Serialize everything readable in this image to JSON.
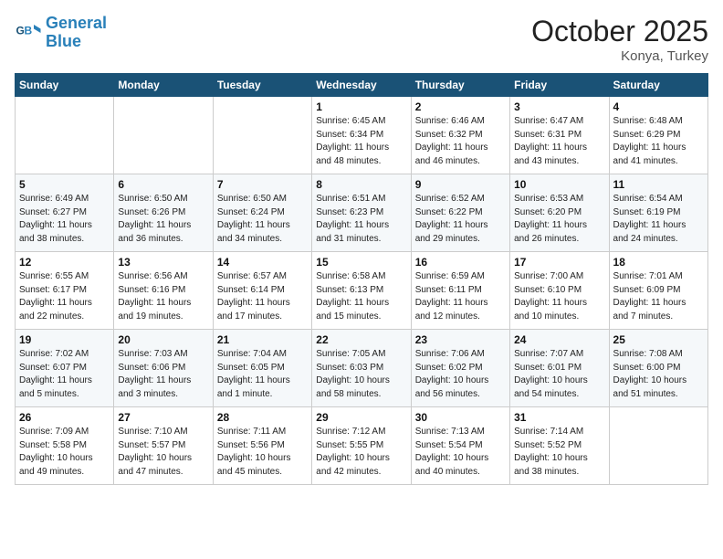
{
  "header": {
    "logo_line1": "General",
    "logo_line2": "Blue",
    "month": "October 2025",
    "location": "Konya, Turkey"
  },
  "days_of_week": [
    "Sunday",
    "Monday",
    "Tuesday",
    "Wednesday",
    "Thursday",
    "Friday",
    "Saturday"
  ],
  "weeks": [
    [
      {
        "day": "",
        "info": ""
      },
      {
        "day": "",
        "info": ""
      },
      {
        "day": "",
        "info": ""
      },
      {
        "day": "1",
        "info": "Sunrise: 6:45 AM\nSunset: 6:34 PM\nDaylight: 11 hours\nand 48 minutes."
      },
      {
        "day": "2",
        "info": "Sunrise: 6:46 AM\nSunset: 6:32 PM\nDaylight: 11 hours\nand 46 minutes."
      },
      {
        "day": "3",
        "info": "Sunrise: 6:47 AM\nSunset: 6:31 PM\nDaylight: 11 hours\nand 43 minutes."
      },
      {
        "day": "4",
        "info": "Sunrise: 6:48 AM\nSunset: 6:29 PM\nDaylight: 11 hours\nand 41 minutes."
      }
    ],
    [
      {
        "day": "5",
        "info": "Sunrise: 6:49 AM\nSunset: 6:27 PM\nDaylight: 11 hours\nand 38 minutes."
      },
      {
        "day": "6",
        "info": "Sunrise: 6:50 AM\nSunset: 6:26 PM\nDaylight: 11 hours\nand 36 minutes."
      },
      {
        "day": "7",
        "info": "Sunrise: 6:50 AM\nSunset: 6:24 PM\nDaylight: 11 hours\nand 34 minutes."
      },
      {
        "day": "8",
        "info": "Sunrise: 6:51 AM\nSunset: 6:23 PM\nDaylight: 11 hours\nand 31 minutes."
      },
      {
        "day": "9",
        "info": "Sunrise: 6:52 AM\nSunset: 6:22 PM\nDaylight: 11 hours\nand 29 minutes."
      },
      {
        "day": "10",
        "info": "Sunrise: 6:53 AM\nSunset: 6:20 PM\nDaylight: 11 hours\nand 26 minutes."
      },
      {
        "day": "11",
        "info": "Sunrise: 6:54 AM\nSunset: 6:19 PM\nDaylight: 11 hours\nand 24 minutes."
      }
    ],
    [
      {
        "day": "12",
        "info": "Sunrise: 6:55 AM\nSunset: 6:17 PM\nDaylight: 11 hours\nand 22 minutes."
      },
      {
        "day": "13",
        "info": "Sunrise: 6:56 AM\nSunset: 6:16 PM\nDaylight: 11 hours\nand 19 minutes."
      },
      {
        "day": "14",
        "info": "Sunrise: 6:57 AM\nSunset: 6:14 PM\nDaylight: 11 hours\nand 17 minutes."
      },
      {
        "day": "15",
        "info": "Sunrise: 6:58 AM\nSunset: 6:13 PM\nDaylight: 11 hours\nand 15 minutes."
      },
      {
        "day": "16",
        "info": "Sunrise: 6:59 AM\nSunset: 6:11 PM\nDaylight: 11 hours\nand 12 minutes."
      },
      {
        "day": "17",
        "info": "Sunrise: 7:00 AM\nSunset: 6:10 PM\nDaylight: 11 hours\nand 10 minutes."
      },
      {
        "day": "18",
        "info": "Sunrise: 7:01 AM\nSunset: 6:09 PM\nDaylight: 11 hours\nand 7 minutes."
      }
    ],
    [
      {
        "day": "19",
        "info": "Sunrise: 7:02 AM\nSunset: 6:07 PM\nDaylight: 11 hours\nand 5 minutes."
      },
      {
        "day": "20",
        "info": "Sunrise: 7:03 AM\nSunset: 6:06 PM\nDaylight: 11 hours\nand 3 minutes."
      },
      {
        "day": "21",
        "info": "Sunrise: 7:04 AM\nSunset: 6:05 PM\nDaylight: 11 hours\nand 1 minute."
      },
      {
        "day": "22",
        "info": "Sunrise: 7:05 AM\nSunset: 6:03 PM\nDaylight: 10 hours\nand 58 minutes."
      },
      {
        "day": "23",
        "info": "Sunrise: 7:06 AM\nSunset: 6:02 PM\nDaylight: 10 hours\nand 56 minutes."
      },
      {
        "day": "24",
        "info": "Sunrise: 7:07 AM\nSunset: 6:01 PM\nDaylight: 10 hours\nand 54 minutes."
      },
      {
        "day": "25",
        "info": "Sunrise: 7:08 AM\nSunset: 6:00 PM\nDaylight: 10 hours\nand 51 minutes."
      }
    ],
    [
      {
        "day": "26",
        "info": "Sunrise: 7:09 AM\nSunset: 5:58 PM\nDaylight: 10 hours\nand 49 minutes."
      },
      {
        "day": "27",
        "info": "Sunrise: 7:10 AM\nSunset: 5:57 PM\nDaylight: 10 hours\nand 47 minutes."
      },
      {
        "day": "28",
        "info": "Sunrise: 7:11 AM\nSunset: 5:56 PM\nDaylight: 10 hours\nand 45 minutes."
      },
      {
        "day": "29",
        "info": "Sunrise: 7:12 AM\nSunset: 5:55 PM\nDaylight: 10 hours\nand 42 minutes."
      },
      {
        "day": "30",
        "info": "Sunrise: 7:13 AM\nSunset: 5:54 PM\nDaylight: 10 hours\nand 40 minutes."
      },
      {
        "day": "31",
        "info": "Sunrise: 7:14 AM\nSunset: 5:52 PM\nDaylight: 10 hours\nand 38 minutes."
      },
      {
        "day": "",
        "info": ""
      }
    ]
  ]
}
